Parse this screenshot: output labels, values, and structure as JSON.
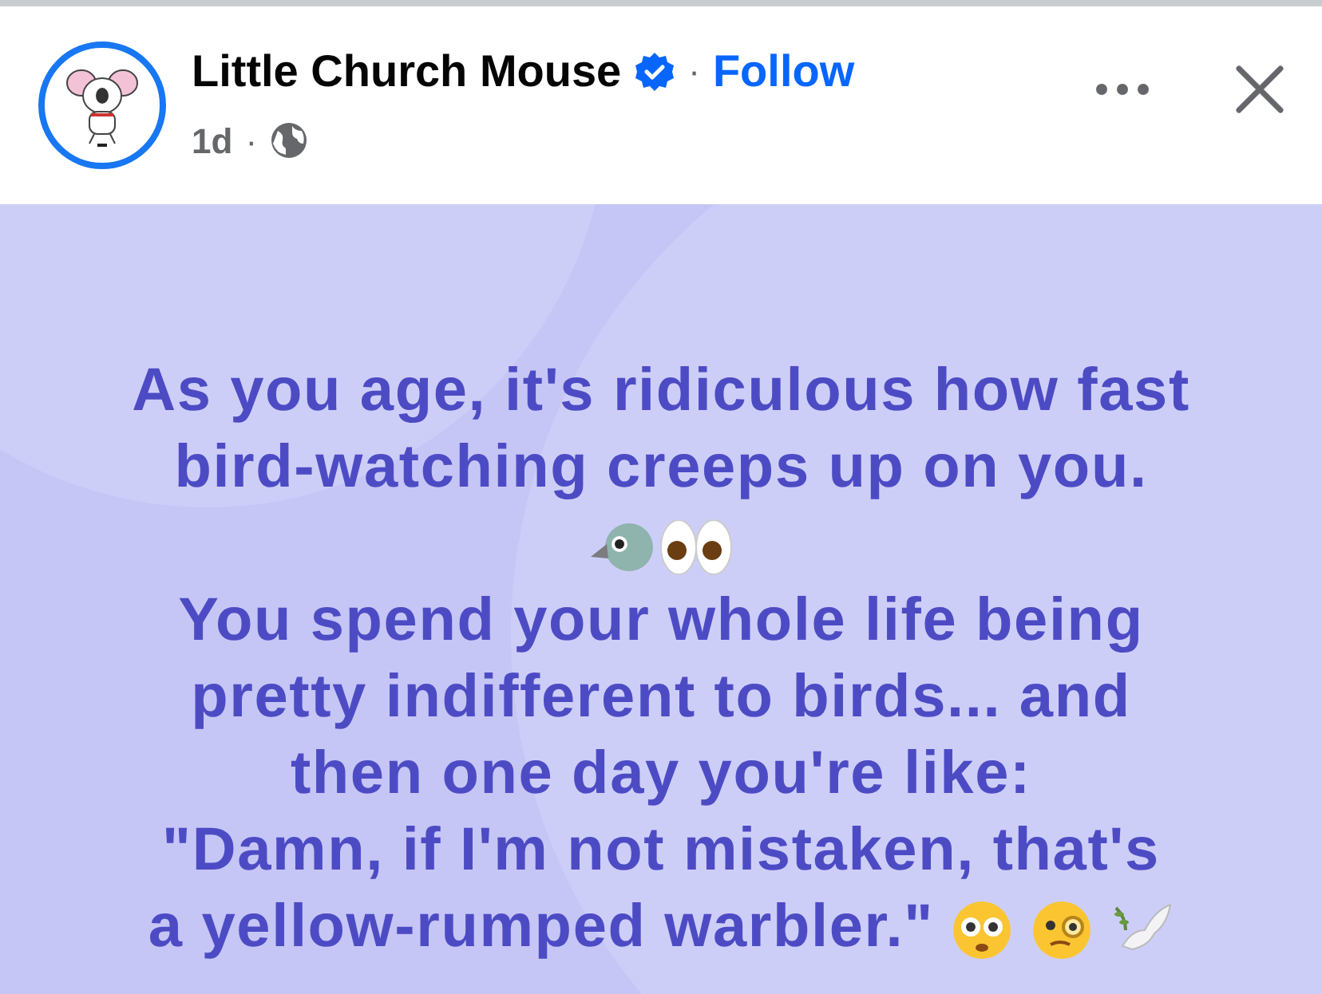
{
  "post": {
    "author": "Little Church Mouse",
    "verified": true,
    "separator": "·",
    "follow": "Follow",
    "time": "1d",
    "time_separator": "·",
    "lines": [
      {
        "kind": "text",
        "text": "As you age, it's ridiculous how fast"
      },
      {
        "kind": "text",
        "text": "bird-watching creeps up on you."
      },
      {
        "kind": "emoji-row"
      },
      {
        "kind": "text",
        "text": "You spend your whole life being"
      },
      {
        "kind": "text",
        "text": "pretty indifferent to birds... and"
      },
      {
        "kind": "text",
        "text": "then one day you're like:"
      },
      {
        "kind": "text",
        "text": "\"Damn, if I'm not mistaken, that's"
      },
      {
        "kind": "text-with-emoji",
        "text": "a yellow-rumped warbler.\""
      }
    ]
  }
}
